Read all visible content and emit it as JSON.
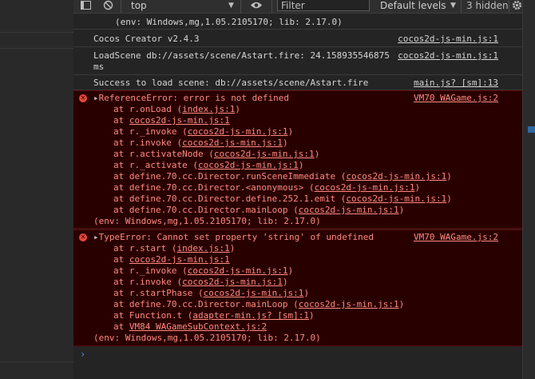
{
  "toolbar": {
    "context": "top",
    "filter_placeholder": "Filter",
    "levels": "Default levels",
    "hidden": "3 hidden"
  },
  "messages": [
    {
      "type": "info",
      "text": "(env: Windows,mg,1.05.2105170; lib: 2.17.0)",
      "source": ""
    },
    {
      "type": "info",
      "text": "Cocos Creator v2.4.3",
      "source": "cocos2d-js-min.js:1"
    },
    {
      "type": "info",
      "text": "LoadScene db://assets/scene/Astart.fire: 24.158935546875",
      "text2": "ms",
      "source": "cocos2d-js-min.js:1"
    },
    {
      "type": "info",
      "text": "Success to load scene: db://assets/scene/Astart.fire",
      "source": "main.js? [sm]:13"
    },
    {
      "type": "error",
      "header": "ReferenceError: error is not defined",
      "source": "VM70 WAGame.js:2",
      "frames": [
        {
          "pre": "at r.onLoad (",
          "link": "index.js:1",
          "post": ")"
        },
        {
          "pre": "at ",
          "link": "cocos2d-js-min.js:1",
          "post": ""
        },
        {
          "pre": "at r._invoke (",
          "link": "cocos2d-js-min.js:1",
          "post": ")"
        },
        {
          "pre": "at r.invoke (",
          "link": "cocos2d-js-min.js:1",
          "post": ")"
        },
        {
          "pre": "at r.activateNode (",
          "link": "cocos2d-js-min.js:1",
          "post": ")"
        },
        {
          "pre": "at r._activate (",
          "link": "cocos2d-js-min.js:1",
          "post": ")"
        },
        {
          "pre": "at define.70.cc.Director.runSceneImmediate (",
          "link": "cocos2d-js-min.js:1",
          "post": ")"
        },
        {
          "pre": "at define.70.cc.Director.<anonymous> (",
          "link": "cocos2d-js-min.js:1",
          "post": ")"
        },
        {
          "pre": "at define.70.cc.Director.define.252.1.emit (",
          "link": "cocos2d-js-min.js:1",
          "post": ")"
        },
        {
          "pre": "at define.70.cc.Director.mainLoop (",
          "link": "cocos2d-js-min.js:1",
          "post": ")"
        }
      ],
      "env": "(env: Windows,mg,1.05.2105170; lib: 2.17.0)"
    },
    {
      "type": "error",
      "header": "TypeError: Cannot set property 'string' of undefined",
      "source": "VM70 WAGame.js:2",
      "frames": [
        {
          "pre": "at r.start (",
          "link": "index.js:1",
          "post": ")"
        },
        {
          "pre": "at ",
          "link": "cocos2d-js-min.js:1",
          "post": ""
        },
        {
          "pre": "at r._invoke (",
          "link": "cocos2d-js-min.js:1",
          "post": ")"
        },
        {
          "pre": "at r.invoke (",
          "link": "cocos2d-js-min.js:1",
          "post": ")"
        },
        {
          "pre": "at r.startPhase (",
          "link": "cocos2d-js-min.js:1",
          "post": ")"
        },
        {
          "pre": "at define.70.cc.Director.mainLoop (",
          "link": "cocos2d-js-min.js:1",
          "post": ")"
        },
        {
          "pre": "at Function.t (",
          "link": "adapter-min.js? [sm]:1",
          "post": ")"
        },
        {
          "pre": "at ",
          "link": "VM84 WAGameSubContext.js:2",
          "post": ""
        }
      ],
      "env": "(env: Windows,mg,1.05.2105170; lib: 2.17.0)"
    }
  ],
  "colors": {
    "error_text": "#ff8a80",
    "error_bg": "#290000",
    "prompt": "#4d8fe8"
  },
  "icons": {
    "sidebar": "sidebar-toggle-icon",
    "clear": "clear-console-icon",
    "eye": "live-expression-eye-icon",
    "gear": "settings-gear-icon",
    "prompt": "prompt-chevron-icon"
  }
}
